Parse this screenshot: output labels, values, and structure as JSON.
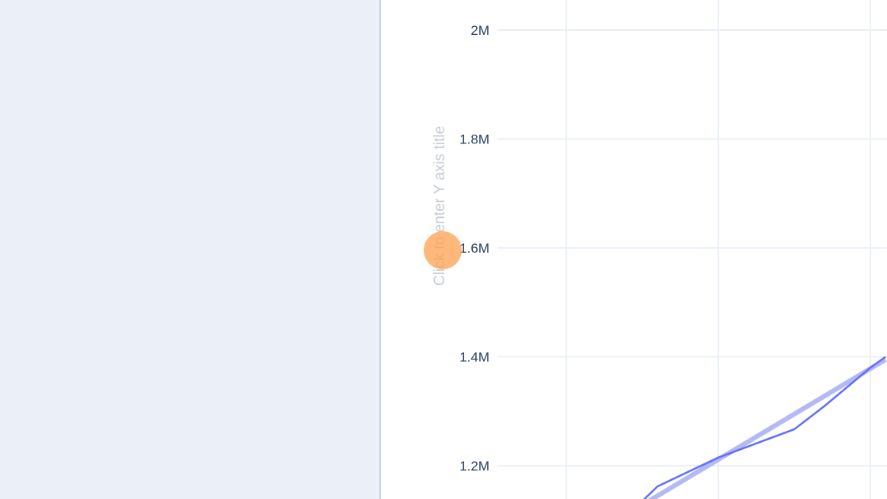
{
  "editor": {
    "y_axis_title_placeholder": "Click to enter Y axis title"
  },
  "colors": {
    "series_line": "#636efa",
    "trendline": "#b4b9f5",
    "grid": "#ebf0f8",
    "panel_bg": "#ebf0f8",
    "cursor_highlight": "#ffa050"
  },
  "chart_data": {
    "type": "line",
    "title": "",
    "xlabel": "",
    "ylabel": "",
    "grid": true,
    "y_ticks": [
      "1.2M",
      "1.4M",
      "1.6M",
      "1.8M",
      "2M"
    ],
    "y_tick_values": [
      1200000,
      1400000,
      1600000,
      1800000,
      2000000
    ],
    "ylim": [
      1135000,
      2055000
    ],
    "x_gridline_count": 3,
    "series": [
      {
        "style": "line",
        "points": [
          [
            0.5,
            1135000
          ],
          [
            0.6,
            1162000
          ],
          [
            1.0,
            1215000
          ],
          [
            1.5,
            1267000
          ],
          [
            1.7,
            1310000
          ],
          [
            2.0,
            1380000
          ],
          [
            2.1,
            1400000
          ]
        ]
      },
      {
        "style": "trendline",
        "points": [
          [
            0.5,
            1128000
          ],
          [
            2.1,
            1395000
          ]
        ]
      }
    ]
  }
}
